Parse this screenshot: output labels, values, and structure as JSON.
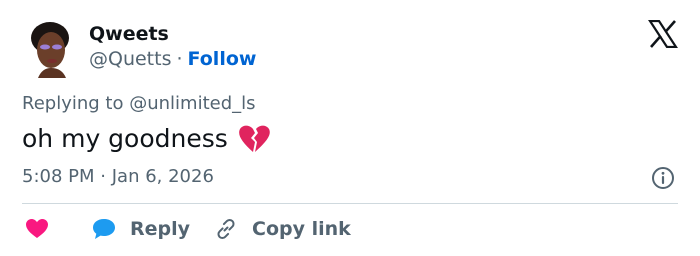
{
  "tweet": {
    "author_name": "Qweets",
    "handle": "@Quetts",
    "separator": "·",
    "follow_label": "Follow",
    "replying_prefix": "Replying to",
    "replying_to": "@unlimited_ls",
    "text": "oh my goodness",
    "emoji": "broken-heart",
    "time": "5:08 PM",
    "date": "Jan 6, 2026"
  },
  "actions": {
    "like_icon": "heart-icon",
    "reply_label": "Reply",
    "copy_label": "Copy link"
  },
  "colors": {
    "text_primary": "#0f1419",
    "text_secondary": "#536471",
    "link_blue": "#0064d2",
    "like_pink": "#f91880",
    "reply_blue": "#1d9bf0",
    "divider": "#cfd9de",
    "broken_heart_red": "#e0245e"
  }
}
